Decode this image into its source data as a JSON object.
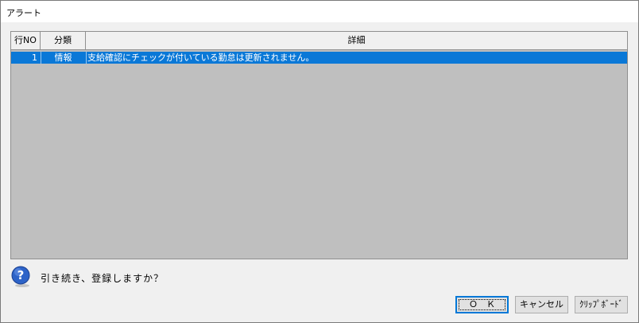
{
  "window": {
    "title": "アラート"
  },
  "grid": {
    "headers": {
      "row_no": "行NO",
      "category": "分類",
      "detail": "詳細"
    },
    "rows": [
      {
        "row_no": "1",
        "category": "情報",
        "detail": "支給確認にチェックが付いている勤怠は更新されません。"
      }
    ]
  },
  "prompt": {
    "icon": "question-icon",
    "text": "引き続き、登録しますか？"
  },
  "buttons": {
    "ok": "Ｏ　Ｋ",
    "cancel": "キャンセル",
    "clipboard": "ｸﾘｯﾌﾟﾎﾞｰﾄﾞ"
  },
  "colors": {
    "selection": "#0a78d7",
    "grid_background": "#bfbfbf",
    "default_button_border": "#0078d7"
  }
}
